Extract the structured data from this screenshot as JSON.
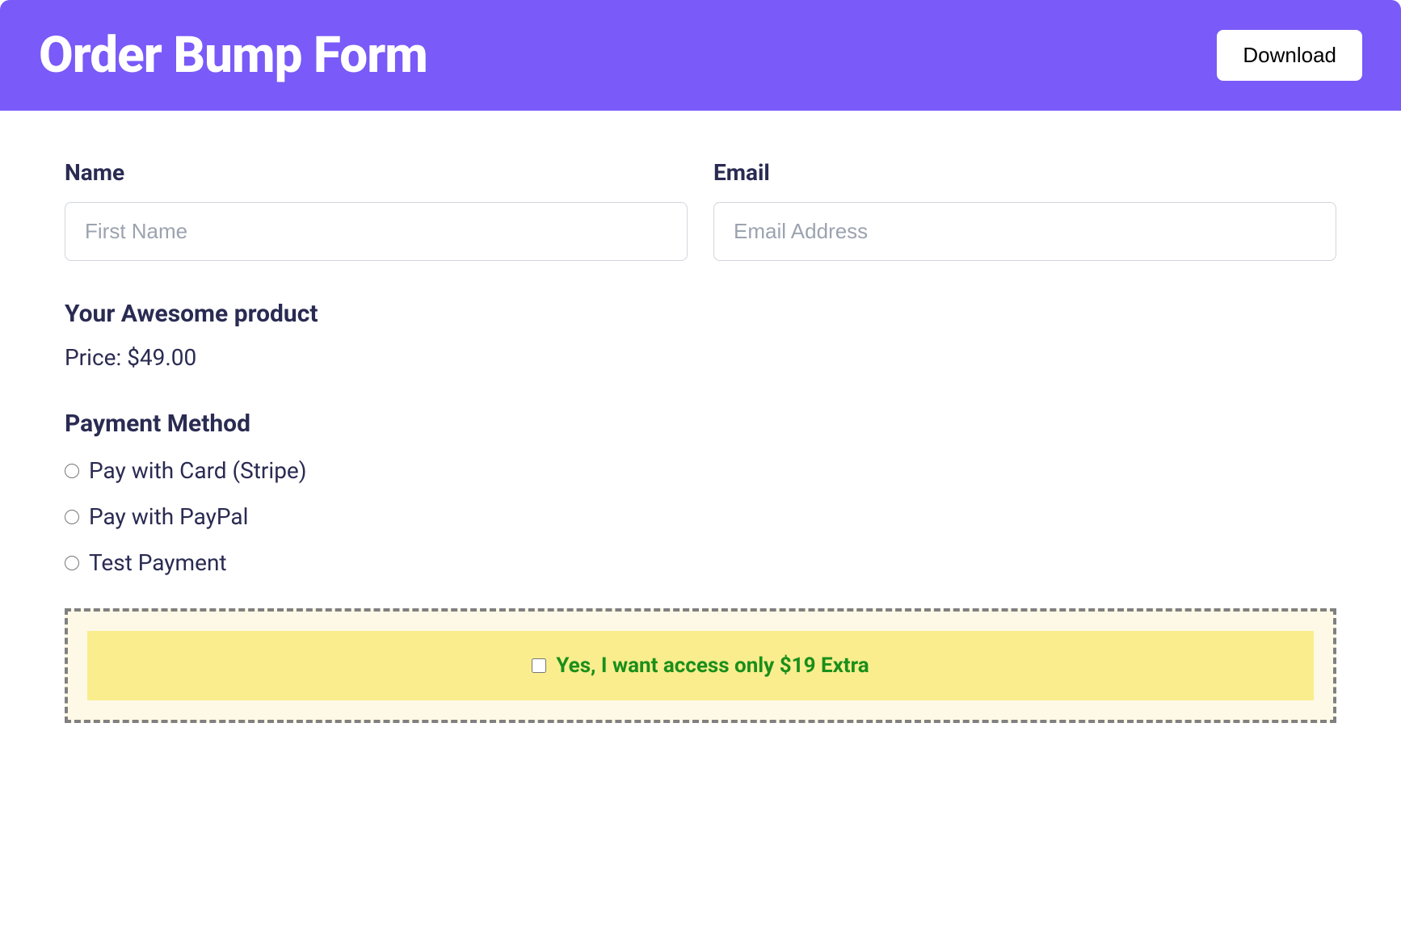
{
  "header": {
    "title": "Order Bump Form",
    "download_label": "Download"
  },
  "form": {
    "name": {
      "label": "Name",
      "placeholder": "First Name",
      "value": ""
    },
    "email": {
      "label": "Email",
      "placeholder": "Email Address",
      "value": ""
    }
  },
  "product": {
    "title": "Your Awesome product",
    "price_label": "Price: $49.00"
  },
  "payment": {
    "title": "Payment Method",
    "options": [
      {
        "label": "Pay with Card (Stripe)"
      },
      {
        "label": "Pay with PayPal"
      },
      {
        "label": "Test Payment"
      }
    ]
  },
  "bump": {
    "text": "Yes, I want access only $19 Extra"
  }
}
